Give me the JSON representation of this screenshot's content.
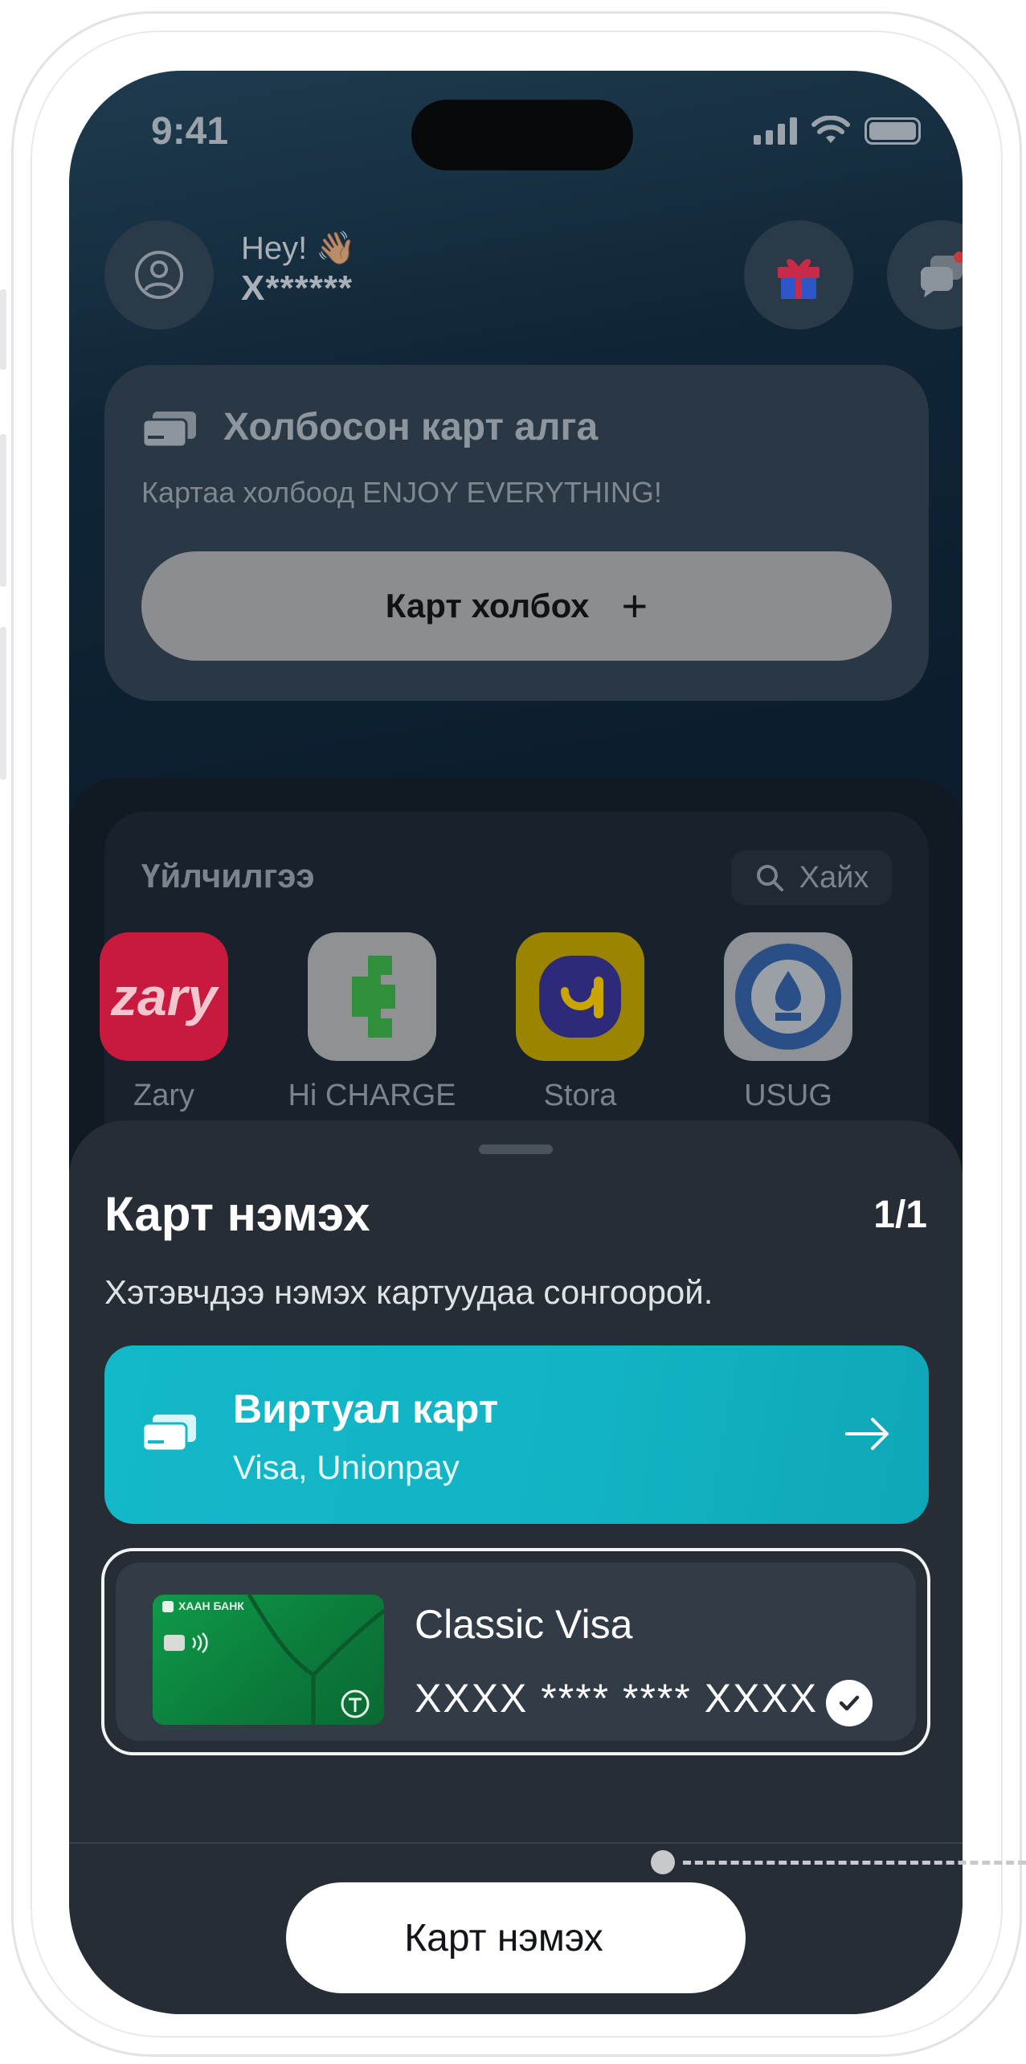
{
  "status_bar": {
    "time": "9:41"
  },
  "header": {
    "greeting": "Hey! 👋🏽",
    "username": "Х******"
  },
  "no_card": {
    "title": "Холбосон карт алга",
    "subtitle": "Картаа холбоод ENJOY EVERYTHING!",
    "link_button": "Карт холбох",
    "link_button_icon": "plus-icon"
  },
  "services": {
    "title": "Үйлчилгээ",
    "search_label": "Хайх",
    "apps": [
      {
        "label": "Zary",
        "icon_text": "zary",
        "color": "#d81d43"
      },
      {
        "label": "Hi CHARGE",
        "color": "#e8e9ea"
      },
      {
        "label": "Stora",
        "color": "#f2c200"
      },
      {
        "label": "USUG",
        "color": "#eef1f5"
      }
    ]
  },
  "sheet": {
    "title": "Карт нэмэх",
    "counter": "1/1",
    "subtitle": "Хэтэвчдээ нэмэх картуудаа сонгоорой.",
    "virtual_card": {
      "title": "Виртуал карт",
      "subtitle": "Visa, Unionpay"
    },
    "classic_card": {
      "title": "Classic Visa",
      "number": "XXXX **** **** XXXX",
      "bank_label": "ХААН БАНК",
      "selected": true
    },
    "add_button": "Карт нэмэх"
  },
  "colors": {
    "accent_teal": "#13b8c9",
    "card_green": "#0f9a4a",
    "sheet_bg": "#262d35"
  }
}
